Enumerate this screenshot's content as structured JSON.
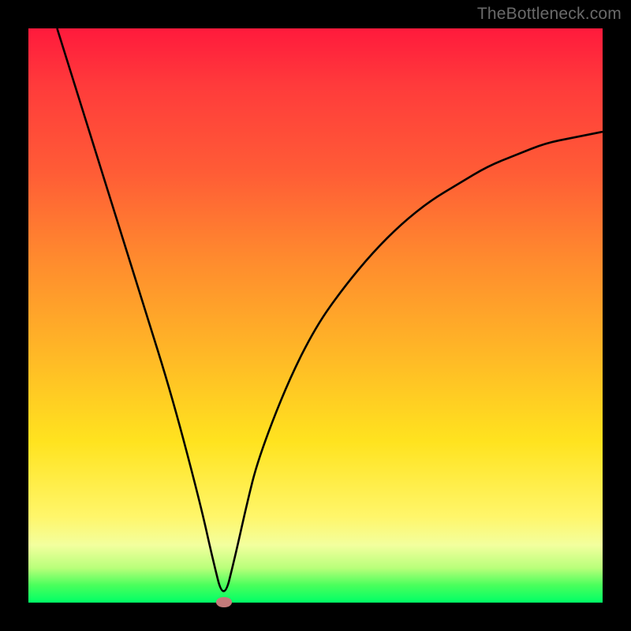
{
  "watermark": "TheBottleneck.com",
  "chart_data": {
    "type": "line",
    "title": "",
    "xlabel": "",
    "ylabel": "",
    "xlim": [
      0,
      100
    ],
    "ylim": [
      0,
      100
    ],
    "background_gradient": [
      "#ff1a3c",
      "#ff8a2e",
      "#ffe31f",
      "#00ff66"
    ],
    "minimum": {
      "x": 34,
      "y": 0
    },
    "series": [
      {
        "name": "bottleneck-curve",
        "x": [
          5,
          10,
          15,
          20,
          25,
          30,
          32,
          34,
          36,
          38,
          40,
          45,
          50,
          55,
          60,
          65,
          70,
          75,
          80,
          85,
          90,
          95,
          100
        ],
        "values": [
          100,
          84,
          68,
          52,
          36,
          17,
          8,
          0,
          8,
          17,
          25,
          38,
          48,
          55,
          61,
          66,
          70,
          73,
          76,
          78,
          80,
          81,
          82
        ]
      }
    ]
  },
  "colors": {
    "curve": "#000000",
    "dot": "#c47a7a",
    "frame": "#000000"
  }
}
